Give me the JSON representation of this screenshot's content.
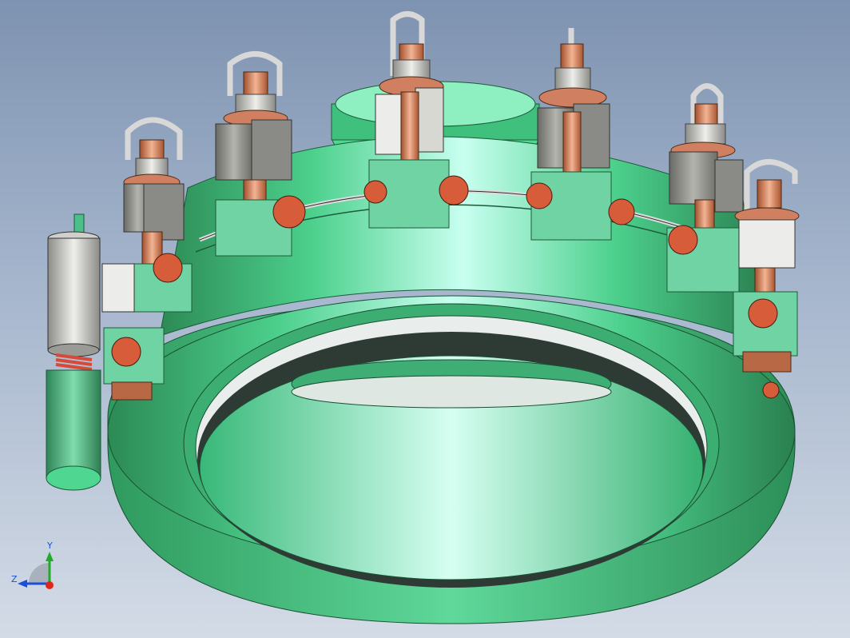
{
  "viewport": {
    "background_top": "#7e93b1",
    "background_bottom": "#d3dbe6"
  },
  "model": {
    "body_color": "#3cc07e",
    "body_highlight": "#c8fff0",
    "copper_color": "#cd7a55",
    "grey_color": "#8a8a86",
    "white_color": "#eeeeea",
    "spring_color": "#d64a3a",
    "terminal_count": 8
  },
  "triad": {
    "y_label": "Y",
    "z_label": "Z",
    "x_axis_color": "#e0261a",
    "y_axis_color": "#22aa2a",
    "z_axis_color": "#1b4fd6"
  }
}
